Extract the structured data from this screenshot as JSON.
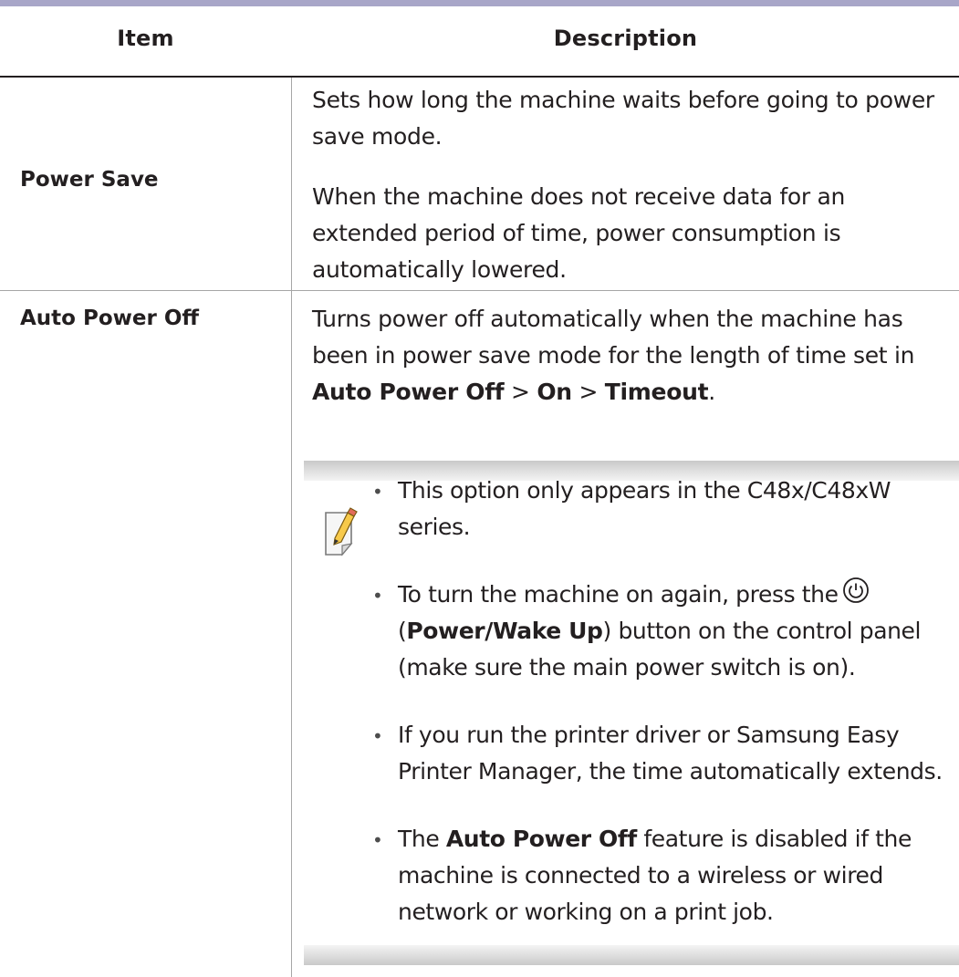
{
  "table": {
    "headers": {
      "item": "Item",
      "description": "Description"
    },
    "rows": [
      {
        "item": "Power Save",
        "description": [
          "Sets how long the machine waits before going to power save mode.",
          "When the machine does not receive data for an extended period of time, power consumption is automatically lowered."
        ]
      },
      {
        "item": "Auto Power Off",
        "description_line1": "Turns power off automatically when the machine has been in power save mode for the length of time set in",
        "path": {
          "a": "Auto Power Off",
          "sep1": ">",
          "b": "On",
          "sep2": ">",
          "c": "Timeout",
          "end": "."
        },
        "note": {
          "icon": "note-pencil-icon",
          "bullet": "•",
          "items": {
            "one": "This option only appears in the C48x/C48xW series.",
            "two_pre": "To turn the machine on again, press the",
            "two_paren_open": "(",
            "two_bold": "Power/Wake Up",
            "two_post": ") button on the control panel (make sure the main power switch is on).",
            "three": "If you run the printer driver or Samsung Easy Printer Manager, the time automatically extends.",
            "four_pre": "The",
            "four_bold": "Auto Power Off",
            "four_post": "feature is disabled if the machine is connected to a wireless or wired network or working on a print job."
          },
          "power_icon": "power-icon"
        }
      }
    ]
  }
}
